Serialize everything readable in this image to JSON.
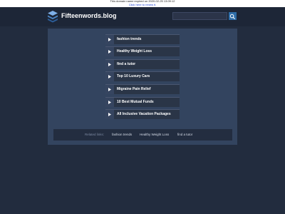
{
  "banner": {
    "text": "This domain name expired on 2020-02-25 13:09:12",
    "renew_link": "Click here to renew it."
  },
  "header": {
    "site_title": "Fifteenwords.blog",
    "search_placeholder": ""
  },
  "links": [
    {
      "label": "fashion trends"
    },
    {
      "label": "Healthy Weight Loss"
    },
    {
      "label": "find a tutor"
    },
    {
      "label": "Top 10 Luxury Cars"
    },
    {
      "label": "Migraine Pain Relief"
    },
    {
      "label": "10 Best Mutual Funds"
    },
    {
      "label": "All Inclusive Vacation Packages"
    }
  ],
  "related": {
    "heading": "Related links:",
    "items": [
      "fashion trends",
      "Healthy Weight Loss",
      "find a tutor"
    ]
  },
  "colors": {
    "background": "#222c3e",
    "panel": "#33445f",
    "accent": "#2e6da8"
  },
  "icons": {
    "logo": "stacked-layers-icon",
    "search": "search-icon",
    "row_arrow": "play-arrow-icon"
  }
}
